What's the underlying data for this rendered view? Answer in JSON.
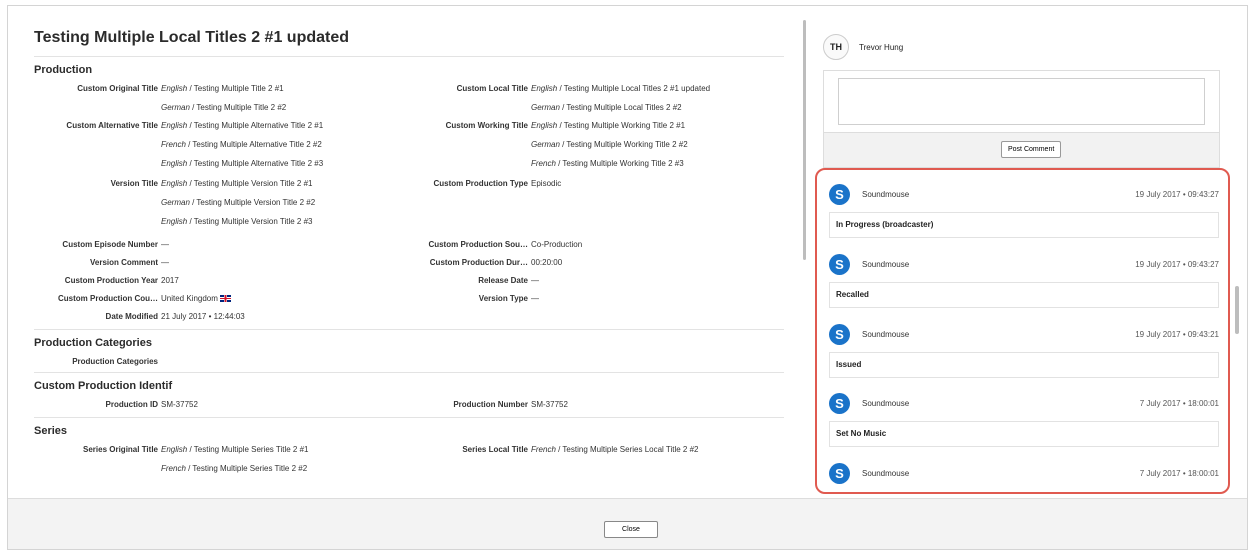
{
  "title": "Testing Multiple Local Titles 2 #1 updated",
  "sections": {
    "production": "Production",
    "production_categories": "Production Categories",
    "custom_production_identif": "Custom Production Identif",
    "series": "Series"
  },
  "fields": {
    "custom_original_title": {
      "label": "Custom Original Title",
      "values": [
        {
          "lang": "English",
          "text": " / Testing Multiple Title 2 #1"
        },
        {
          "lang": "German",
          "text": " / Testing Multiple Title 2 #2"
        }
      ]
    },
    "custom_local_title": {
      "label": "Custom Local Title",
      "values": [
        {
          "lang": "English",
          "text": " / Testing Multiple Local Titles 2 #1 updated"
        },
        {
          "lang": "German",
          "text": " / Testing Multiple Local Titles 2 #2"
        }
      ]
    },
    "custom_alternative_title": {
      "label": "Custom Alternative Title",
      "values": [
        {
          "lang": "English",
          "text": " / Testing Multiple Alternative Title 2 #1"
        },
        {
          "lang": "French",
          "text": " / Testing Multiple Alternative Title 2 #2"
        },
        {
          "lang": "English",
          "text": " / Testing Multiple Alternative Title 2 #3"
        }
      ]
    },
    "custom_working_title": {
      "label": "Custom Working Title",
      "values": [
        {
          "lang": "English",
          "text": " / Testing Multiple Working Title 2 #1"
        },
        {
          "lang": "German",
          "text": " / Testing Multiple Working Title 2 #2"
        },
        {
          "lang": "French",
          "text": " / Testing Multiple Working Title 2 #3"
        }
      ]
    },
    "version_title": {
      "label": "Version Title",
      "values": [
        {
          "lang": "English",
          "text": " / Testing Multiple Version Title 2 #1"
        },
        {
          "lang": "German",
          "text": " / Testing Multiple Version Title 2 #2"
        },
        {
          "lang": "English",
          "text": " / Testing Multiple Version Title 2 #3"
        }
      ]
    },
    "custom_production_type": {
      "label": "Custom Production Type",
      "value": "Episodic"
    },
    "custom_episode_number": {
      "label": "Custom Episode Number",
      "value": "—"
    },
    "custom_production_source": {
      "label": "Custom Production Sou…",
      "value": "Co-Production"
    },
    "version_comment": {
      "label": "Version Comment",
      "value": "—"
    },
    "custom_production_duration": {
      "label": "Custom Production Dur…",
      "value": "00:20:00"
    },
    "custom_production_year": {
      "label": "Custom Production Year",
      "value": "2017"
    },
    "release_date": {
      "label": "Release Date",
      "value": "—"
    },
    "custom_production_country": {
      "label": "Custom Production Cou…",
      "value": "United Kingdom",
      "icon": "uk-flag-icon"
    },
    "version_type": {
      "label": "Version Type",
      "value": "—"
    },
    "date_modified": {
      "label": "Date Modified",
      "value": "21 July 2017 • 12:44:03"
    },
    "production_categories": {
      "label": "Production Categories"
    },
    "production_id": {
      "label": "Production ID",
      "value": "SM-37752"
    },
    "production_number": {
      "label": "Production Number",
      "value": "SM-37752"
    },
    "series_original_title": {
      "label": "Series Original Title",
      "values": [
        {
          "lang": "English",
          "text": " / Testing Multiple Series Title 2 #1"
        },
        {
          "lang": "French",
          "text": " / Testing Multiple Series Title 2 #2"
        }
      ]
    },
    "series_local_title": {
      "label": "Series Local Title",
      "values": [
        {
          "lang": "French",
          "text": " / Testing Multiple Series Local Title 2 #2"
        }
      ]
    }
  },
  "comments": {
    "user_initials": "TH",
    "user_name": "Trevor Hung",
    "post_button": "Post Comment"
  },
  "activity": [
    {
      "author": "Soundmouse",
      "time": "19 July 2017 • 09:43:27",
      "status": "In Progress (broadcaster)"
    },
    {
      "author": "Soundmouse",
      "time": "19 July 2017 • 09:43:27",
      "status": "Recalled"
    },
    {
      "author": "Soundmouse",
      "time": "19 July 2017 • 09:43:21",
      "status": "Issued"
    },
    {
      "author": "Soundmouse",
      "time": "7 July 2017 • 18:00:01",
      "status": "Set No Music"
    },
    {
      "author": "Soundmouse",
      "time": "7 July 2017 • 18:00:01",
      "status": ""
    }
  ],
  "activity_logo_letter": "S",
  "footer": {
    "close_label": "Close"
  },
  "colors": {
    "highlight_border": "#e05a50",
    "soundmouse_blue": "#1a73c9"
  }
}
